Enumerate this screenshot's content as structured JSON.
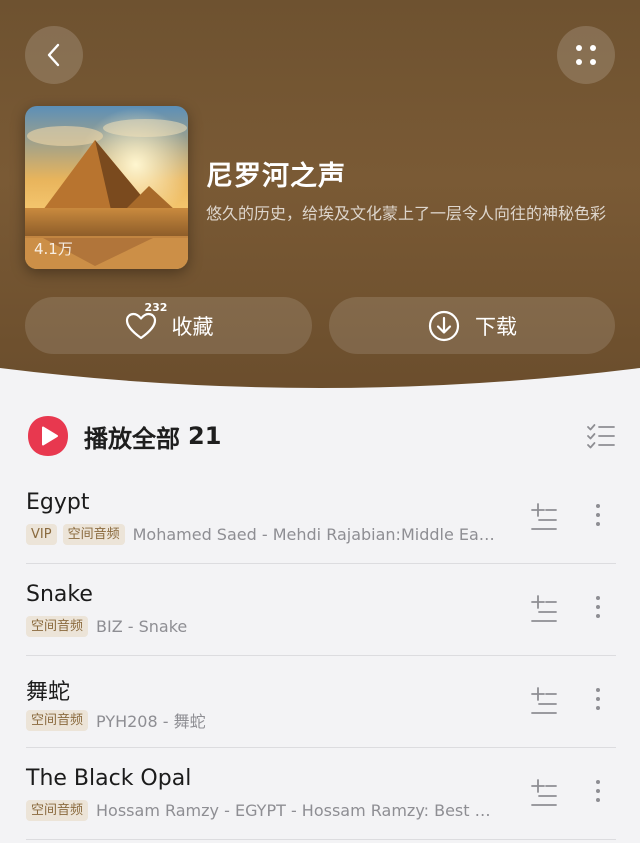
{
  "header": {
    "play_count": "4.1万",
    "title": "尼罗河之声",
    "description": "悠久的历史，给埃及文化蒙上了一层令人向往的神秘色彩"
  },
  "actions": {
    "favorite_label": "收藏",
    "favorite_count": "232",
    "download_label": "下载"
  },
  "play_all": {
    "label": "播放全部",
    "count": "21"
  },
  "songs": [
    {
      "title": "Egypt",
      "tags": [
        "VIP",
        "空间音频"
      ],
      "artist": "Mohamed Saed - Mehdi Rajabian:Middle Eastern Music"
    },
    {
      "title": "Snake",
      "tags": [
        "空间音频"
      ],
      "artist": "BIZ - Snake"
    },
    {
      "title": "舞蛇",
      "tags": [
        "空间音频"
      ],
      "artist": "PYH208 - 舞蛇"
    },
    {
      "title": "The Black Opal",
      "tags": [
        "空间音频"
      ],
      "artist": "Hossam Ramzy - EGYPT - Hossam Ramzy: Best of Egypt"
    }
  ],
  "icons": {
    "back": "chevron-left-icon",
    "more": "four-dots-icon",
    "favorite": "heart-icon",
    "download": "download-circle-icon",
    "play_all": "play-circle-icon",
    "multi_select": "checklist-icon",
    "add_to_playlist": "add-list-icon",
    "song_more": "vertical-dots-icon"
  },
  "colors": {
    "header_bg": "#6e5230",
    "play_accent": "#e8384f",
    "tag_bg": "#ece4d8",
    "tag_text": "#8a6a3e"
  }
}
